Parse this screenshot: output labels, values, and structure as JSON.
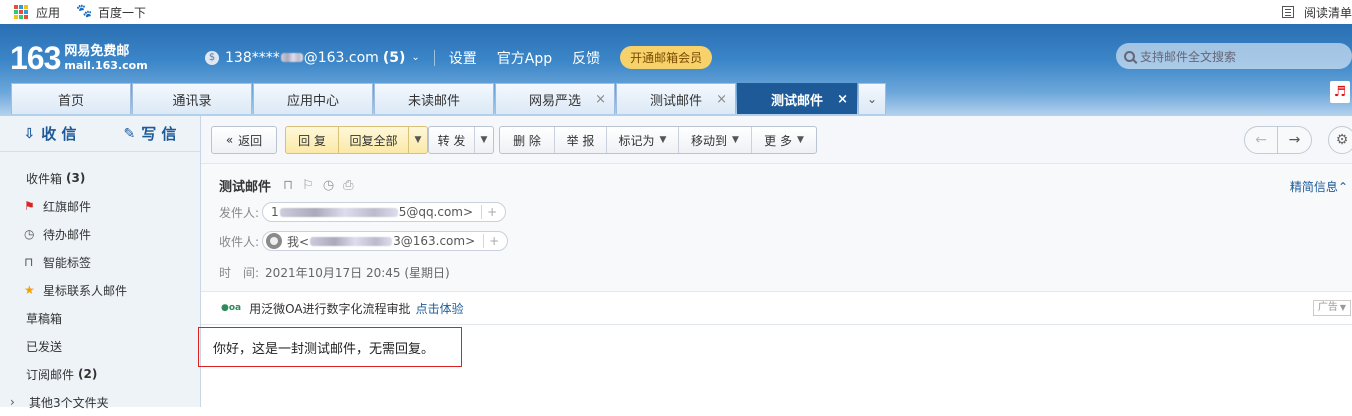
{
  "bookmarks": {
    "apps_label": "应用",
    "baidu_label": "百度一下",
    "reading_list_label": "阅读清单"
  },
  "header": {
    "logo_number": "163",
    "logo_title": "网易免费邮",
    "logo_domain": "mail.163.com",
    "account_prefix": "138****",
    "account_suffix": "@163.com",
    "unread_count": "(5)",
    "links": [
      "设置",
      "官方App",
      "反馈"
    ],
    "vip_label": "开通邮箱会员",
    "search_placeholder": "支持邮件全文搜索"
  },
  "tabs": [
    {
      "label": "首页",
      "closable": false,
      "active": false
    },
    {
      "label": "通讯录",
      "closable": false,
      "active": false
    },
    {
      "label": "应用中心",
      "closable": false,
      "active": false
    },
    {
      "label": "未读邮件",
      "closable": false,
      "active": false
    },
    {
      "label": "网易严选",
      "closable": true,
      "active": false
    },
    {
      "label": "测试邮件",
      "closable": true,
      "active": false
    },
    {
      "label": "测试邮件",
      "closable": true,
      "active": true
    }
  ],
  "sidebar": {
    "receive_label": "收 信",
    "compose_label": "写 信",
    "folders": [
      {
        "label": "收件箱",
        "count": "(3)"
      },
      {
        "label": "红旗邮件",
        "count": ""
      },
      {
        "label": "待办邮件",
        "count": ""
      },
      {
        "label": "智能标签",
        "count": ""
      },
      {
        "label": "星标联系人邮件",
        "count": ""
      },
      {
        "label": "草稿箱",
        "count": ""
      },
      {
        "label": "已发送",
        "count": ""
      },
      {
        "label": "订阅邮件",
        "count": "(2)"
      },
      {
        "label": "其他3个文件夹",
        "count": ""
      }
    ]
  },
  "toolbar": {
    "back_label": "返回",
    "reply_label": "回 复",
    "reply_all_label": "回复全部",
    "forward_label": "转 发",
    "delete_label": "删 除",
    "report_label": "举 报",
    "mark_label": "标记为",
    "move_label": "移动到",
    "more_label": "更 多"
  },
  "mail": {
    "subject": "测试邮件",
    "detail_toggle": "精简信息",
    "from_label": "发件人:",
    "from_prefix": "1",
    "from_suffix": "5@qq.com>",
    "to_label": "收件人:",
    "to_name": "我<",
    "to_suffix": "3@163.com>",
    "time_label": "时　间:",
    "time_value": "2021年10月17日 20:45 (星期日)",
    "ad_text": "用泛微OA进行数字化流程审批",
    "ad_link": "点击体验",
    "ad_tag": "广告",
    "body": "你好，这是一封测试邮件，无需回复。"
  },
  "colors": {
    "header_top": "#2a6fb3",
    "active_tab": "#1e5a98",
    "vip_button": "#f7d26a",
    "highlight_border": "#dd2222"
  }
}
